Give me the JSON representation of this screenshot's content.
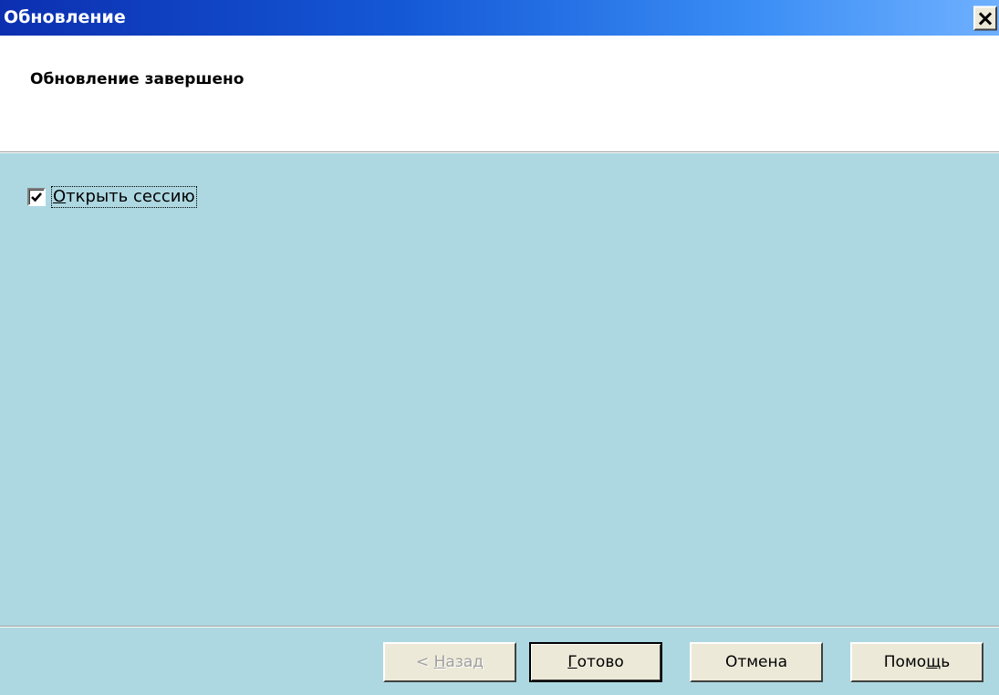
{
  "window": {
    "title": "Обновление",
    "close_label": "×"
  },
  "header": {
    "title": "Обновление завершено"
  },
  "content": {
    "checkbox": {
      "label_prefix": "О",
      "label_rest": "ткрыть сессию",
      "checked": true
    }
  },
  "buttons": {
    "back": {
      "prefix": "< ",
      "mnemonic": "Н",
      "rest": "азад",
      "enabled": false
    },
    "finish": {
      "mnemonic": "Г",
      "rest": "отово"
    },
    "cancel": {
      "label": "Отмена"
    },
    "help": {
      "prefix": "Помо",
      "mnemonic": "щ",
      "rest": "ь"
    }
  },
  "colors": {
    "titlebar_start": "#0c2fb0",
    "titlebar_end": "#6fb0ff",
    "content_bg": "#add8e1",
    "header_bg": "#ffffff",
    "button_face": "#ece9d8"
  },
  "icons": {
    "close": "close-icon",
    "check": "checkmark-icon"
  }
}
